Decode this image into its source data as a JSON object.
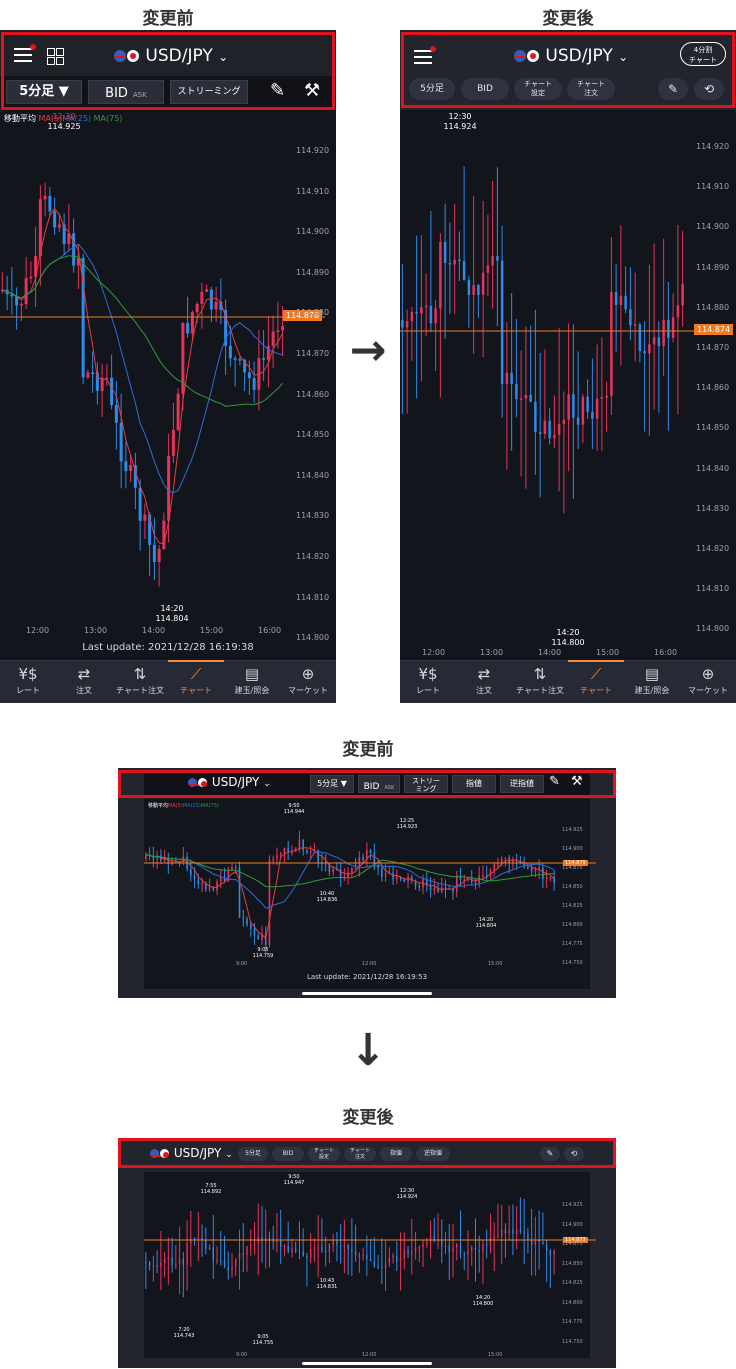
{
  "labels": {
    "before_top": "変更前",
    "after_top": "変更後",
    "before_bottom": "変更前",
    "after_bottom": "変更後"
  },
  "colors": {
    "highlight": "#e0141e",
    "bull": "#e8325a",
    "bear": "#2e8be8",
    "price_line": "#f07a20",
    "ma5": "#e83c3c",
    "ma25": "#2e6bd8",
    "ma75": "#2f9a3a"
  },
  "arrow_right": "→",
  "arrow_down": "↓",
  "portrait_before": {
    "pair": "USD/JPY",
    "timeframe": "5分足 ▼",
    "bid": "BID",
    "ask": "ASK",
    "streaming": "ストリーミング",
    "menu_icon": "hamburger-icon",
    "grid_icon": "grid-icon",
    "legend_label": "移動平均",
    "ma5": "MA(5)",
    "ma25": "MA(25)",
    "ma75": "MA(75)",
    "high_time": "12:30",
    "high_value": "114.925",
    "low_time": "14:20",
    "low_value": "114.804",
    "current_price": "114.878",
    "last_update": "Last update:  2021/12/28 16:19:38",
    "yticks": [
      "114.920",
      "114.910",
      "114.900",
      "114.890",
      "114.880",
      "114.870",
      "114.860",
      "114.850",
      "114.840",
      "114.830",
      "114.820",
      "114.810",
      "114.800"
    ],
    "xticks": [
      "12:00",
      "13:00",
      "14:00",
      "15:00",
      "16:00"
    ]
  },
  "portrait_after": {
    "pair": "USD/JPY",
    "split": "4分割\nチャート",
    "timeframe": "5分足",
    "bid": "BID",
    "chart_settings": "チャート\n設定",
    "chart_order": "チャート\n注文",
    "high_time": "12:30",
    "high_value": "114.924",
    "low_time": "14:20",
    "low_value": "114.800",
    "current_price": "114.874",
    "yticks": [
      "114.920",
      "114.910",
      "114.900",
      "114.890",
      "114.880",
      "114.870",
      "114.860",
      "114.850",
      "114.840",
      "114.830",
      "114.820",
      "114.810",
      "114.800"
    ],
    "xticks": [
      "12:00",
      "13:00",
      "14:00",
      "15:00",
      "16:00"
    ]
  },
  "nav": [
    {
      "label": "レート",
      "icon": "¥$"
    },
    {
      "label": "注文",
      "icon": "⇄"
    },
    {
      "label": "チャート注文",
      "icon": "⇅"
    },
    {
      "label": "チャート",
      "icon": "⟋"
    },
    {
      "label": "建玉/照会",
      "icon": "▤"
    },
    {
      "label": "マーケット",
      "icon": "⊕"
    }
  ],
  "landscape_before": {
    "pair": "USD/JPY",
    "timeframe": "5分足 ▼",
    "bid": "BID",
    "ask": "ASK",
    "streaming": "ストリー\nミング",
    "limit": "指値",
    "stop": "逆指値",
    "legend_label": "移動平均",
    "ma5": "MA(5)",
    "ma25": "MA(25)",
    "ma75": "MA(75)",
    "annots": [
      {
        "t": "9:50",
        "v": "114.944"
      },
      {
        "t": "12:25",
        "v": "114.923"
      },
      {
        "t": "10:40",
        "v": "114.836"
      },
      {
        "t": "14:20",
        "v": "114.804"
      },
      {
        "t": "9:05",
        "v": "114.759"
      }
    ],
    "current_price": "114.879",
    "last_update": "Last update:  2021/12/28 16:19:53",
    "yticks": [
      "114.925",
      "114.900",
      "114.875",
      "114.850",
      "114.825",
      "114.800",
      "114.775",
      "114.750"
    ],
    "xticks": [
      "9:00",
      "12:00",
      "15:00"
    ]
  },
  "landscape_after": {
    "pair": "USD/JPY",
    "timeframe": "5分足",
    "bid": "BID",
    "chart_settings": "チャート\n設定",
    "chart_order": "チャート\n注文",
    "limit": "指値",
    "stop": "逆指値",
    "annots": [
      {
        "t": "9:50",
        "v": "114.947"
      },
      {
        "t": "7:55",
        "v": "114.892"
      },
      {
        "t": "12:30",
        "v": "114.924"
      },
      {
        "t": "10:43",
        "v": "114.831"
      },
      {
        "t": "14:20",
        "v": "114.800"
      },
      {
        "t": "7:20",
        "v": "114.743"
      },
      {
        "t": "9:05",
        "v": "114.755"
      }
    ],
    "current_price": "114.873",
    "yticks": [
      "114.925",
      "114.900",
      "114.875",
      "114.850",
      "114.825",
      "114.800",
      "114.775",
      "114.750"
    ],
    "xticks": [
      "9:00",
      "12:00",
      "15:00"
    ]
  }
}
